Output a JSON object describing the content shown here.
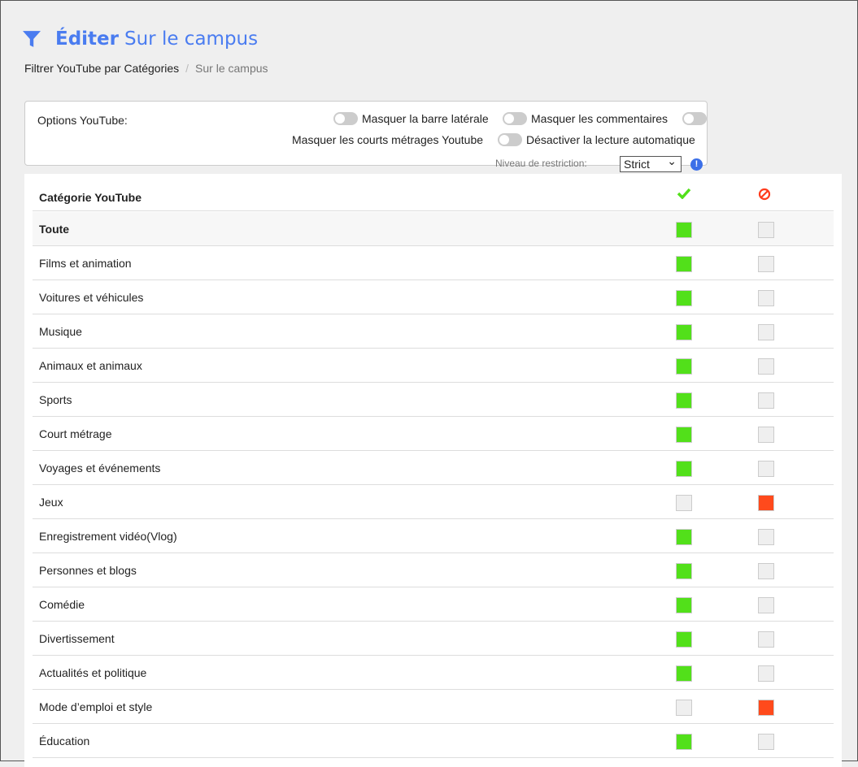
{
  "header": {
    "title_bold": "Éditer",
    "title_rest": "Sur le campus",
    "icon": "filter-icon"
  },
  "breadcrumb": {
    "parent": "Filtrer YouTube par Catégories",
    "separator": "/",
    "current": "Sur le campus"
  },
  "options": {
    "label": "Options YouTube:",
    "toggles": [
      {
        "label": "Masquer la barre latérale",
        "on": false
      },
      {
        "label": "Masquer les commentaires",
        "on": false
      },
      {
        "label": "Masquer les courts métrages Youtube",
        "on": false
      },
      {
        "label": "Désactiver la lecture automatique",
        "on": false
      }
    ],
    "restriction_label": "Niveau de restriction:",
    "restriction_value": "Strict",
    "info_icon": "!"
  },
  "table": {
    "header": "Catégorie YouTube",
    "allow_color": "#52e01a",
    "block_color": "#ff4a1c",
    "rows": [
      {
        "name": "Toute",
        "allowed": true
      },
      {
        "name": "Films et animation",
        "allowed": true
      },
      {
        "name": "Voitures et véhicules",
        "allowed": true
      },
      {
        "name": "Musique",
        "allowed": true
      },
      {
        "name": "Animaux et animaux",
        "allowed": true
      },
      {
        "name": "Sports",
        "allowed": true
      },
      {
        "name": "Court métrage",
        "allowed": true
      },
      {
        "name": "Voyages et événements",
        "allowed": true
      },
      {
        "name": "Jeux",
        "allowed": false
      },
      {
        "name": "Enregistrement vidéo(Vlog)",
        "allowed": true
      },
      {
        "name": "Personnes et blogs",
        "allowed": true
      },
      {
        "name": "Comédie",
        "allowed": true
      },
      {
        "name": "Divertissement",
        "allowed": true
      },
      {
        "name": "Actualités et politique",
        "allowed": true
      },
      {
        "name": "Mode d’emploi et style",
        "allowed": false
      },
      {
        "name": "Éducation",
        "allowed": true
      }
    ]
  }
}
